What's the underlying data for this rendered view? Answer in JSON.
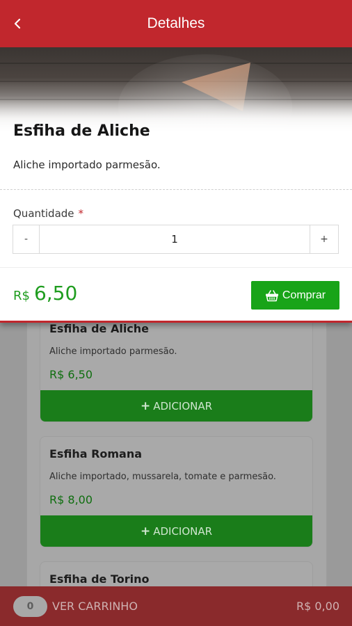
{
  "header": {
    "title": "Detalhes",
    "back_icon": "chevron-left-icon"
  },
  "product": {
    "name": "Esfiha de Aliche",
    "description": "Aliche importado parmesão.",
    "quantity_label": "Quantidade",
    "required_mark": "*",
    "quantity_minus": "-",
    "quantity_value": "1",
    "quantity_plus": "+",
    "price_currency": "R$",
    "price_amount": "6,50",
    "buy_label": "Comprar",
    "buy_icon": "basket-icon"
  },
  "listing": {
    "items": [
      {
        "name": "Esfiha de Aliche",
        "description": "Aliche importado parmesão.",
        "price": "R$ 6,50",
        "button_plus": "+",
        "button_label": "ADICIONAR"
      },
      {
        "name": "Esfiha Romana",
        "description": "Aliche importado, mussarela, tomate e parmesão.",
        "price": "R$ 8,00",
        "button_plus": "+",
        "button_label": "ADICIONAR"
      },
      {
        "name": "Esfiha de Torino"
      }
    ]
  },
  "cart": {
    "count": "0",
    "label": "VER CARRINHO",
    "total": "R$ 0,00"
  },
  "colors": {
    "primary_red": "#c1272d",
    "buy_green": "#18a418",
    "price_green": "#1f9d1f"
  }
}
